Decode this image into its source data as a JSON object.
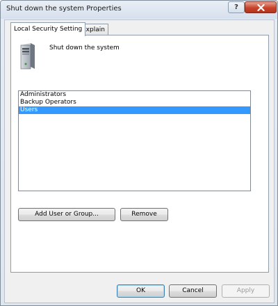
{
  "window": {
    "title": "Shut down the system Properties",
    "help_glyph": "?",
    "close_icon": "close-icon"
  },
  "tabs": [
    {
      "label": "Local Security Setting",
      "active": true
    },
    {
      "label": "Explain",
      "active": false
    }
  ],
  "policy": {
    "icon": "computer-tower-icon",
    "name": "Shut down the system"
  },
  "members": [
    {
      "label": "Administrators",
      "selected": false
    },
    {
      "label": "Backup Operators",
      "selected": false
    },
    {
      "label": "Users",
      "selected": true
    }
  ],
  "actions": {
    "add_label": "Add User or Group...",
    "remove_label": "Remove"
  },
  "dialog_buttons": {
    "ok_label": "OK",
    "cancel_label": "Cancel",
    "apply_label": "Apply",
    "apply_enabled": false
  },
  "colors": {
    "selection": "#3399ff",
    "close_button": "#c8442c"
  }
}
